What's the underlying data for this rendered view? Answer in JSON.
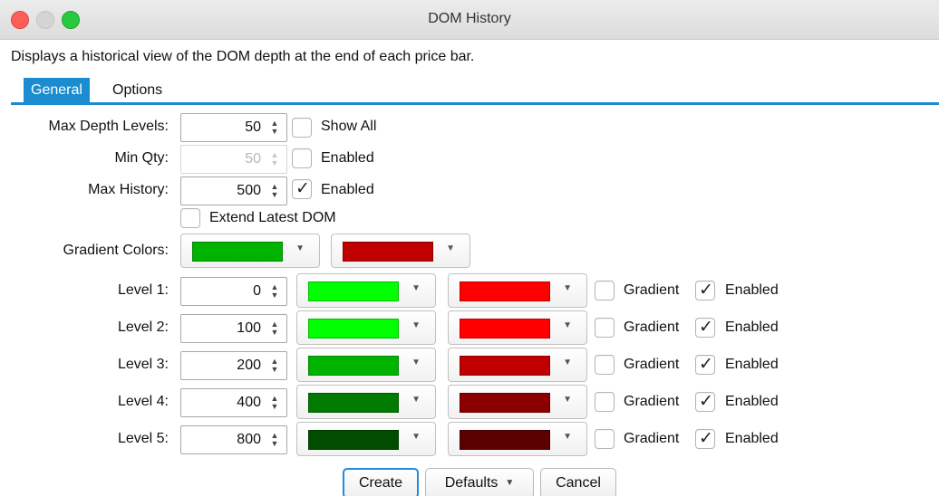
{
  "window": {
    "title": "DOM History"
  },
  "description": "Displays a historical view of the DOM depth at the end of each price bar.",
  "tabs": [
    {
      "label": "General",
      "active": true
    },
    {
      "label": "Options",
      "active": false
    }
  ],
  "max_depth": {
    "label": "Max Depth Levels:",
    "value": "50",
    "checkbox_label": "Show All",
    "checked": false
  },
  "min_qty": {
    "label": "Min Qty:",
    "value": "50",
    "checkbox_label": "Enabled",
    "checked": false,
    "disabled": true
  },
  "max_history": {
    "label": "Max History:",
    "value": "500",
    "checkbox_label": "Enabled",
    "checked": true
  },
  "extend_latest": {
    "label": "Extend Latest DOM",
    "checked": false
  },
  "gradient": {
    "label": "Gradient Colors:",
    "color1": "#00b300",
    "color2": "#c00000"
  },
  "levels": [
    {
      "label": "Level 1:",
      "value": "0",
      "color1": "#00ff00",
      "color2": "#ff0000",
      "gradient_label": "Gradient",
      "gradient_checked": false,
      "enabled_label": "Enabled",
      "enabled_checked": true
    },
    {
      "label": "Level 2:",
      "value": "100",
      "color1": "#00ff00",
      "color2": "#ff0000",
      "gradient_label": "Gradient",
      "gradient_checked": false,
      "enabled_label": "Enabled",
      "enabled_checked": true
    },
    {
      "label": "Level 3:",
      "value": "200",
      "color1": "#00b300",
      "color2": "#c00000",
      "gradient_label": "Gradient",
      "gradient_checked": false,
      "enabled_label": "Enabled",
      "enabled_checked": true
    },
    {
      "label": "Level 4:",
      "value": "400",
      "color1": "#007a00",
      "color2": "#8a0000",
      "gradient_label": "Gradient",
      "gradient_checked": false,
      "enabled_label": "Enabled",
      "enabled_checked": true
    },
    {
      "label": "Level 5:",
      "value": "800",
      "color1": "#004d00",
      "color2": "#5a0000",
      "gradient_label": "Gradient",
      "gradient_checked": false,
      "enabled_label": "Enabled",
      "enabled_checked": true
    }
  ],
  "buttons": {
    "create": "Create",
    "defaults": "Defaults",
    "cancel": "Cancel"
  },
  "icons": {
    "check": "✓",
    "spin_up": "▲",
    "spin_down": "▼",
    "dropdown": "▼"
  }
}
